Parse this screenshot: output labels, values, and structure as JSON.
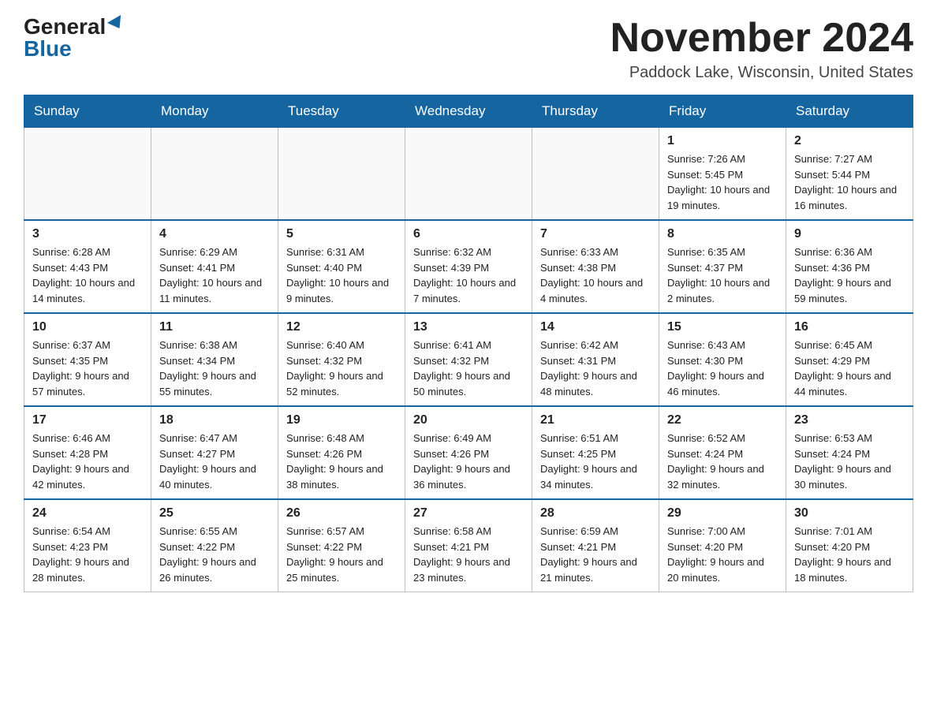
{
  "header": {
    "logo_general": "General",
    "logo_blue": "Blue",
    "month_title": "November 2024",
    "location": "Paddock Lake, Wisconsin, United States"
  },
  "weekdays": [
    "Sunday",
    "Monday",
    "Tuesday",
    "Wednesday",
    "Thursday",
    "Friday",
    "Saturday"
  ],
  "weeks": [
    [
      {
        "day": "",
        "info": ""
      },
      {
        "day": "",
        "info": ""
      },
      {
        "day": "",
        "info": ""
      },
      {
        "day": "",
        "info": ""
      },
      {
        "day": "",
        "info": ""
      },
      {
        "day": "1",
        "info": "Sunrise: 7:26 AM\nSunset: 5:45 PM\nDaylight: 10 hours and 19 minutes."
      },
      {
        "day": "2",
        "info": "Sunrise: 7:27 AM\nSunset: 5:44 PM\nDaylight: 10 hours and 16 minutes."
      }
    ],
    [
      {
        "day": "3",
        "info": "Sunrise: 6:28 AM\nSunset: 4:43 PM\nDaylight: 10 hours and 14 minutes."
      },
      {
        "day": "4",
        "info": "Sunrise: 6:29 AM\nSunset: 4:41 PM\nDaylight: 10 hours and 11 minutes."
      },
      {
        "day": "5",
        "info": "Sunrise: 6:31 AM\nSunset: 4:40 PM\nDaylight: 10 hours and 9 minutes."
      },
      {
        "day": "6",
        "info": "Sunrise: 6:32 AM\nSunset: 4:39 PM\nDaylight: 10 hours and 7 minutes."
      },
      {
        "day": "7",
        "info": "Sunrise: 6:33 AM\nSunset: 4:38 PM\nDaylight: 10 hours and 4 minutes."
      },
      {
        "day": "8",
        "info": "Sunrise: 6:35 AM\nSunset: 4:37 PM\nDaylight: 10 hours and 2 minutes."
      },
      {
        "day": "9",
        "info": "Sunrise: 6:36 AM\nSunset: 4:36 PM\nDaylight: 9 hours and 59 minutes."
      }
    ],
    [
      {
        "day": "10",
        "info": "Sunrise: 6:37 AM\nSunset: 4:35 PM\nDaylight: 9 hours and 57 minutes."
      },
      {
        "day": "11",
        "info": "Sunrise: 6:38 AM\nSunset: 4:34 PM\nDaylight: 9 hours and 55 minutes."
      },
      {
        "day": "12",
        "info": "Sunrise: 6:40 AM\nSunset: 4:32 PM\nDaylight: 9 hours and 52 minutes."
      },
      {
        "day": "13",
        "info": "Sunrise: 6:41 AM\nSunset: 4:32 PM\nDaylight: 9 hours and 50 minutes."
      },
      {
        "day": "14",
        "info": "Sunrise: 6:42 AM\nSunset: 4:31 PM\nDaylight: 9 hours and 48 minutes."
      },
      {
        "day": "15",
        "info": "Sunrise: 6:43 AM\nSunset: 4:30 PM\nDaylight: 9 hours and 46 minutes."
      },
      {
        "day": "16",
        "info": "Sunrise: 6:45 AM\nSunset: 4:29 PM\nDaylight: 9 hours and 44 minutes."
      }
    ],
    [
      {
        "day": "17",
        "info": "Sunrise: 6:46 AM\nSunset: 4:28 PM\nDaylight: 9 hours and 42 minutes."
      },
      {
        "day": "18",
        "info": "Sunrise: 6:47 AM\nSunset: 4:27 PM\nDaylight: 9 hours and 40 minutes."
      },
      {
        "day": "19",
        "info": "Sunrise: 6:48 AM\nSunset: 4:26 PM\nDaylight: 9 hours and 38 minutes."
      },
      {
        "day": "20",
        "info": "Sunrise: 6:49 AM\nSunset: 4:26 PM\nDaylight: 9 hours and 36 minutes."
      },
      {
        "day": "21",
        "info": "Sunrise: 6:51 AM\nSunset: 4:25 PM\nDaylight: 9 hours and 34 minutes."
      },
      {
        "day": "22",
        "info": "Sunrise: 6:52 AM\nSunset: 4:24 PM\nDaylight: 9 hours and 32 minutes."
      },
      {
        "day": "23",
        "info": "Sunrise: 6:53 AM\nSunset: 4:24 PM\nDaylight: 9 hours and 30 minutes."
      }
    ],
    [
      {
        "day": "24",
        "info": "Sunrise: 6:54 AM\nSunset: 4:23 PM\nDaylight: 9 hours and 28 minutes."
      },
      {
        "day": "25",
        "info": "Sunrise: 6:55 AM\nSunset: 4:22 PM\nDaylight: 9 hours and 26 minutes."
      },
      {
        "day": "26",
        "info": "Sunrise: 6:57 AM\nSunset: 4:22 PM\nDaylight: 9 hours and 25 minutes."
      },
      {
        "day": "27",
        "info": "Sunrise: 6:58 AM\nSunset: 4:21 PM\nDaylight: 9 hours and 23 minutes."
      },
      {
        "day": "28",
        "info": "Sunrise: 6:59 AM\nSunset: 4:21 PM\nDaylight: 9 hours and 21 minutes."
      },
      {
        "day": "29",
        "info": "Sunrise: 7:00 AM\nSunset: 4:20 PM\nDaylight: 9 hours and 20 minutes."
      },
      {
        "day": "30",
        "info": "Sunrise: 7:01 AM\nSunset: 4:20 PM\nDaylight: 9 hours and 18 minutes."
      }
    ]
  ]
}
